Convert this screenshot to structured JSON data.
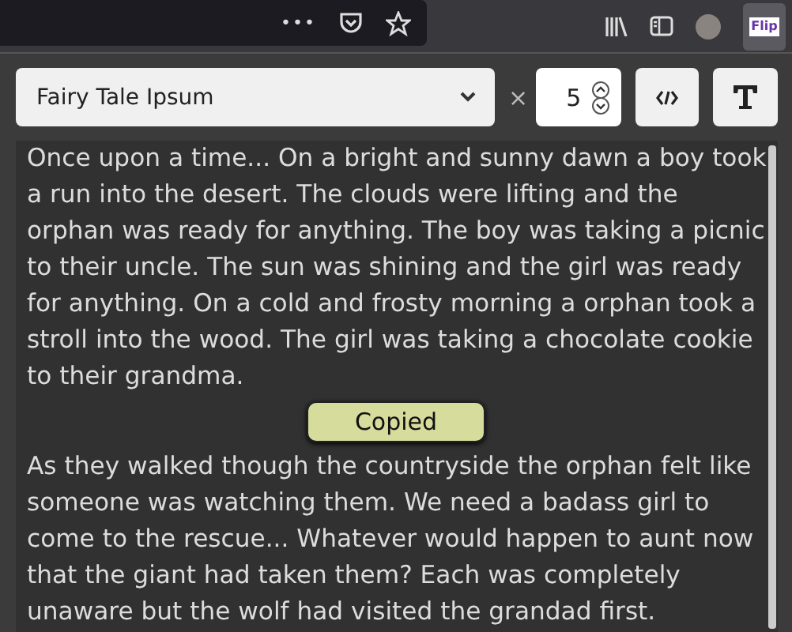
{
  "toolbar": {
    "menu_glyph": "•••"
  },
  "extension": {
    "badge": "Flip"
  },
  "controls": {
    "generator": "Fairy Tale Ipsum",
    "times": "×",
    "count": "5"
  },
  "paragraphs": [
    "Once upon a time... On a bright and sunny dawn a boy took a run into the desert. The clouds were lifting and the orphan was ready for anything. The boy was taking a picnic to their uncle. The sun was shining and the girl was ready for anything. On a cold and frosty morning a orphan took a stroll into the wood. The girl was taking a chocolate cookie to their grandma.",
    "As they walked though the countryside the orphan felt like someone was watching them. We need a badass girl to come to the rescue... Whatever would happen to aunt now that the giant had taken them? Each was completely unaware but the wolf had visited the grandad first."
  ],
  "toast": {
    "text": "Copied"
  }
}
